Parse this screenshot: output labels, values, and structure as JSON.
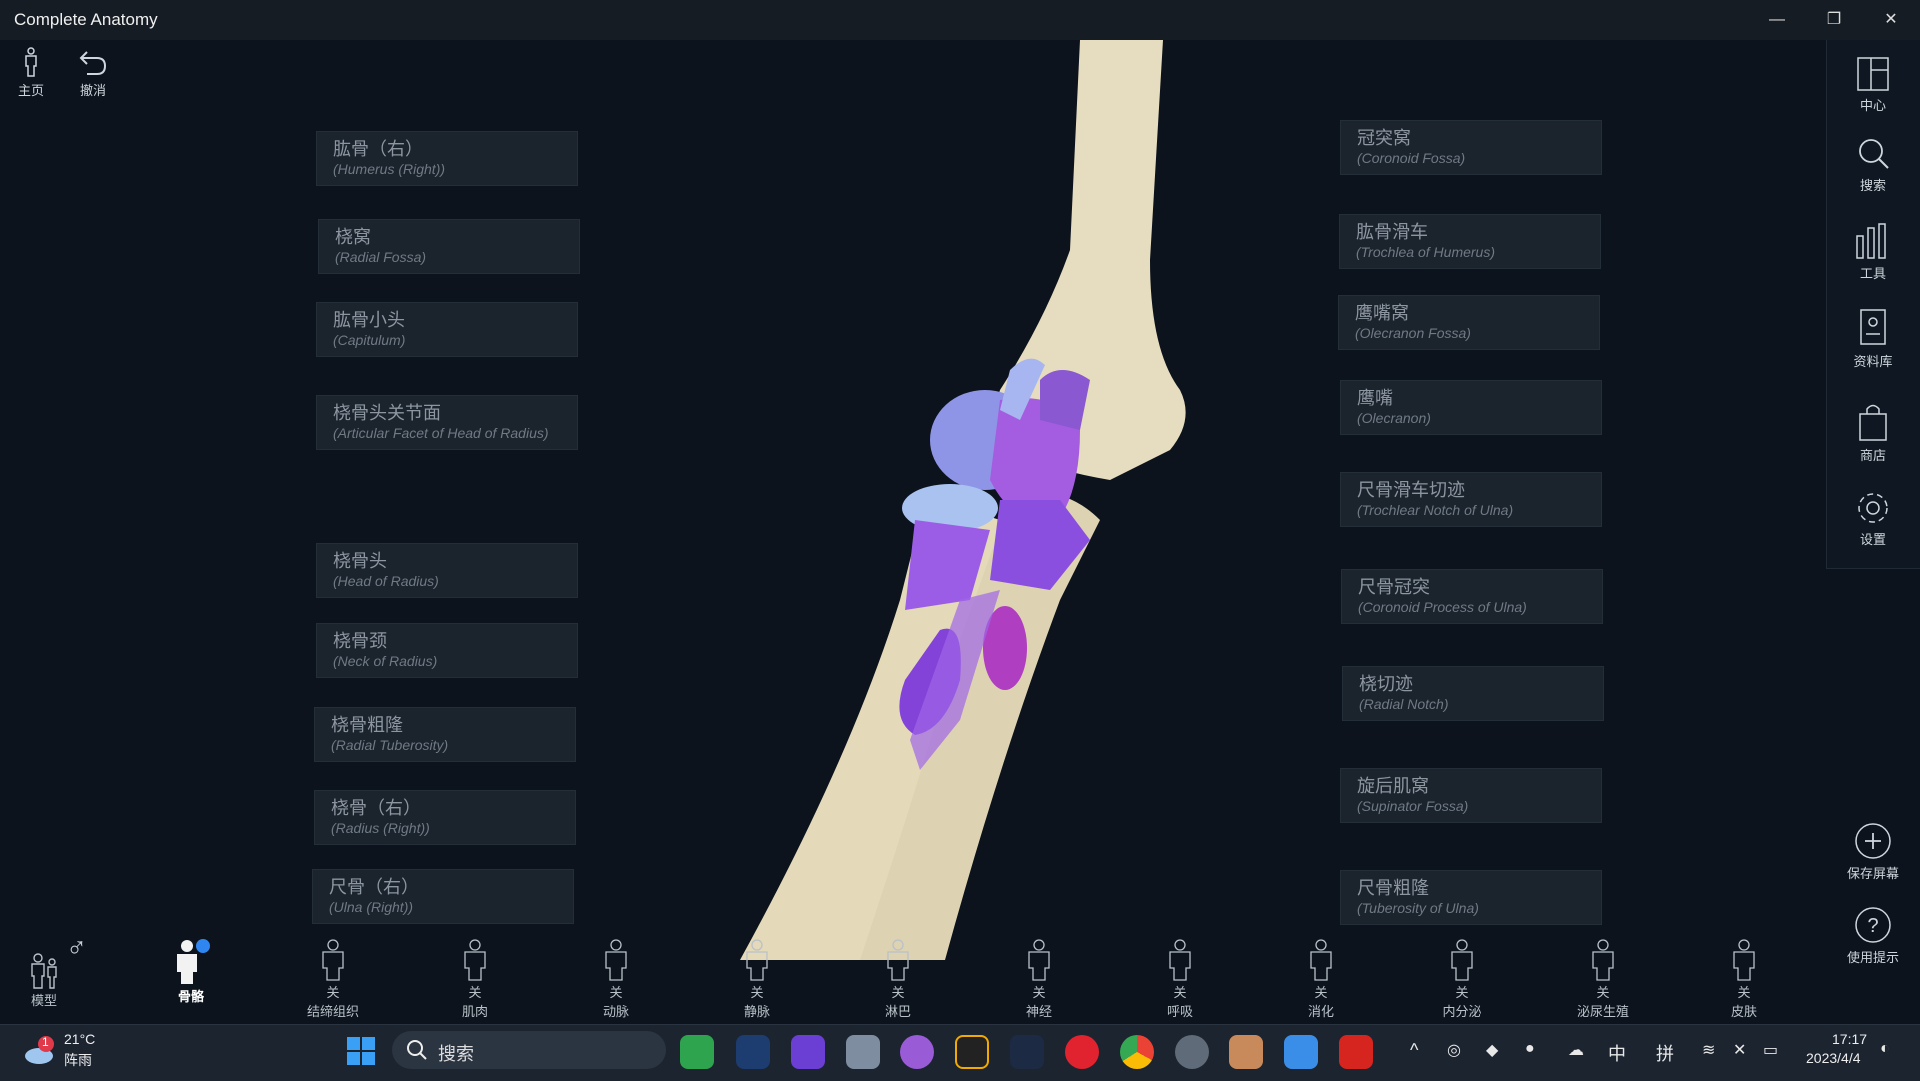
{
  "window": {
    "title": "Complete Anatomy",
    "minimize": "—",
    "restore": "❐",
    "close": "✕"
  },
  "toolbar": {
    "home_label": "主页",
    "undo_label": "撤消"
  },
  "right_menu": [
    {
      "label": "中心",
      "icon": "center-icon"
    },
    {
      "label": "搜索",
      "icon": "search-icon"
    },
    {
      "label": "工具",
      "icon": "tools-icon"
    },
    {
      "label": "资料库",
      "icon": "library-icon"
    },
    {
      "label": "商店",
      "icon": "store-icon"
    },
    {
      "label": "设置",
      "icon": "settings-icon"
    }
  ],
  "right_actions": {
    "save_screen_label": "保存屏幕",
    "usage_tips_label": "使用提示"
  },
  "labels_left": [
    {
      "zh": "肱骨（右）",
      "en": "(Humerus (Right))"
    },
    {
      "zh": "桡窝",
      "en": "(Radial Fossa)"
    },
    {
      "zh": "肱骨小头",
      "en": "(Capitulum)"
    },
    {
      "zh": "桡骨头关节面",
      "en": "(Articular Facet of Head of Radius)"
    },
    {
      "zh": "桡骨头",
      "en": "(Head of Radius)"
    },
    {
      "zh": "桡骨颈",
      "en": "(Neck of Radius)"
    },
    {
      "zh": "桡骨粗隆",
      "en": "(Radial Tuberosity)"
    },
    {
      "zh": "桡骨（右）",
      "en": "(Radius (Right))"
    },
    {
      "zh": "尺骨（右）",
      "en": "(Ulna (Right))"
    }
  ],
  "labels_right": [
    {
      "zh": "冠突窝",
      "en": "(Coronoid Fossa)"
    },
    {
      "zh": "肱骨滑车",
      "en": "(Trochlea of Humerus)"
    },
    {
      "zh": "鹰嘴窝",
      "en": "(Olecranon Fossa)"
    },
    {
      "zh": "鹰嘴",
      "en": "(Olecranon)"
    },
    {
      "zh": "尺骨滑车切迹",
      "en": "(Trochlear Notch of Ulna)"
    },
    {
      "zh": "尺骨冠突",
      "en": "(Coronoid Process of Ulna)"
    },
    {
      "zh": "桡切迹",
      "en": "(Radial Notch)"
    },
    {
      "zh": "旋后肌窝",
      "en": "(Supinator Fossa)"
    },
    {
      "zh": "尺骨粗隆",
      "en": "(Tuberosity of Ulna)"
    }
  ],
  "systems_bar": {
    "model_label": "模型",
    "gender_symbol": "♂",
    "items": [
      {
        "top": "",
        "label": "骨骼",
        "active": true
      },
      {
        "top": "关",
        "label": "结缔组织"
      },
      {
        "top": "关",
        "label": "肌肉"
      },
      {
        "top": "关",
        "label": "动脉"
      },
      {
        "top": "关",
        "label": "静脉"
      },
      {
        "top": "关",
        "label": "淋巴"
      },
      {
        "top": "关",
        "label": "神经"
      },
      {
        "top": "关",
        "label": "呼吸"
      },
      {
        "top": "关",
        "label": "消化"
      },
      {
        "top": "关",
        "label": "内分泌"
      },
      {
        "top": "关",
        "label": "泌尿生殖"
      },
      {
        "top": "关",
        "label": "皮肤"
      }
    ]
  },
  "taskbar": {
    "weather_temp": "21°C",
    "weather_desc": "阵雨",
    "weather_badge": "1",
    "search_placeholder": "搜索",
    "ime_lang": "中",
    "ime_mode": "拼",
    "time": "17:17",
    "date": "2023/4/4"
  },
  "colors": {
    "bone": "#e8dfc4",
    "highlight_purple": "#9b5de5",
    "highlight_blue": "#8f95e6",
    "panel": "#1b232d",
    "accent_blue": "#2f86f0"
  }
}
